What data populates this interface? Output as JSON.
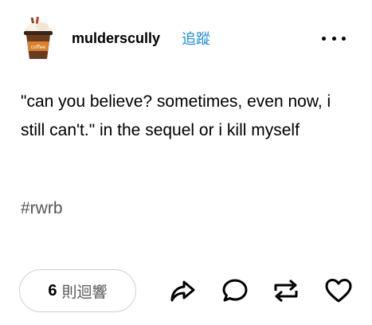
{
  "post": {
    "username": "mulderscully",
    "follow_label": "追蹤",
    "body": "\"can you believe? sometimes, even now, i still can't.\" in the sequel or i kill myself",
    "tag": "#rwrb",
    "notes_count": "6",
    "notes_label": "則迴響"
  },
  "icons": {
    "avatar": "coffee-cup-avatar",
    "more": "more-dots-icon",
    "share": "share-icon",
    "reply": "reply-icon",
    "reblog": "reblog-icon",
    "like": "heart-icon"
  }
}
